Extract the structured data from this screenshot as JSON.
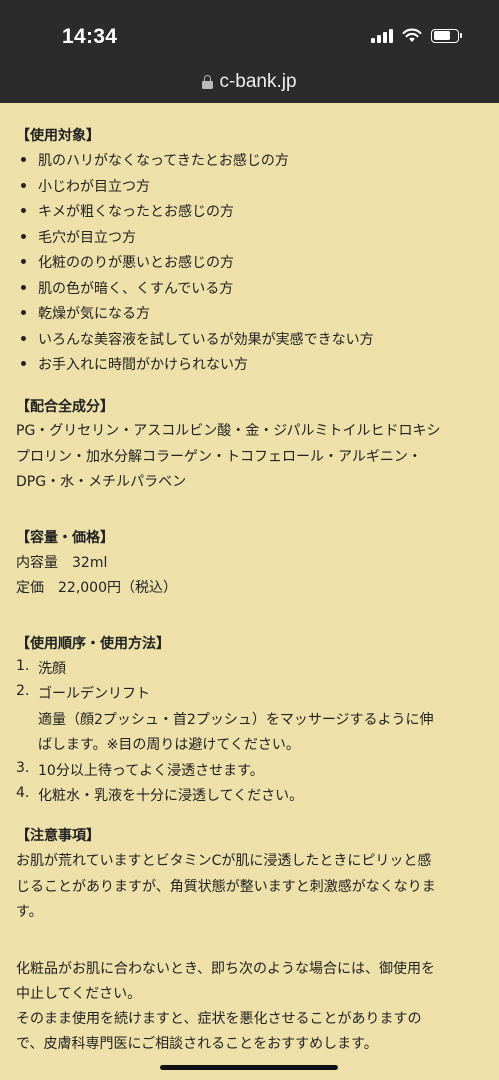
{
  "status_bar": {
    "time": "14:34"
  },
  "browser": {
    "url": "c-bank.jp"
  },
  "sections": {
    "target": {
      "heading": "【使用対象】",
      "items": [
        "肌のハリがなくなってきたとお感じの方",
        "小じわが目立つ方",
        "キメが粗くなったとお感じの方",
        "毛穴が目立つ方",
        "化粧ののりが悪いとお感じの方",
        "肌の色が暗く、くすんでいる方",
        "乾燥が気になる方",
        "いろんな美容液を試しているが効果が実感できない方",
        "お手入れに時間がかけられない方"
      ]
    },
    "ingredients": {
      "heading": "【配合全成分】",
      "lines": [
        "PG・グリセリン・アスコルビン酸・金・ジパルミトイルヒドロキシ",
        "プロリン・加水分解コラーゲン・トコフェロール・アルギニン・",
        "DPG・水・メチルパラベン"
      ]
    },
    "volume_price": {
      "heading": "【容量・価格】",
      "lines": [
        "内容量　32ml",
        "定価　22,000円（税込）"
      ]
    },
    "usage": {
      "heading": "【使用順序・使用方法】",
      "steps": [
        {
          "n": "1.",
          "text": "洗顔"
        },
        {
          "n": "2.",
          "text": "ゴールデンリフト"
        },
        {
          "n": "3.",
          "text": "10分以上待ってよく浸透させます。"
        },
        {
          "n": "4.",
          "text": "化粧水・乳液を十分に浸透してください。"
        }
      ],
      "step2_detail": [
        "適量（顔2プッシュ・首2プッシュ）をマッサージするように伸",
        "ばします。※目の周りは避けてください。"
      ]
    },
    "caution": {
      "heading": "【注意事項】",
      "para1": [
        "お肌が荒れていますとビタミンCが肌に浸透したときにピリッと感",
        "じることがありますが、角質状態が整いますと刺激感がなくなりま",
        "す。"
      ],
      "para2": [
        "化粧品がお肌に合わないとき、即ち次のような場合には、御使用を",
        "中止してください。",
        "そのまま使用を続けますと、症状を悪化させることがありますの",
        "で、皮膚科専門医にご相談されることをおすすめします。"
      ]
    }
  }
}
